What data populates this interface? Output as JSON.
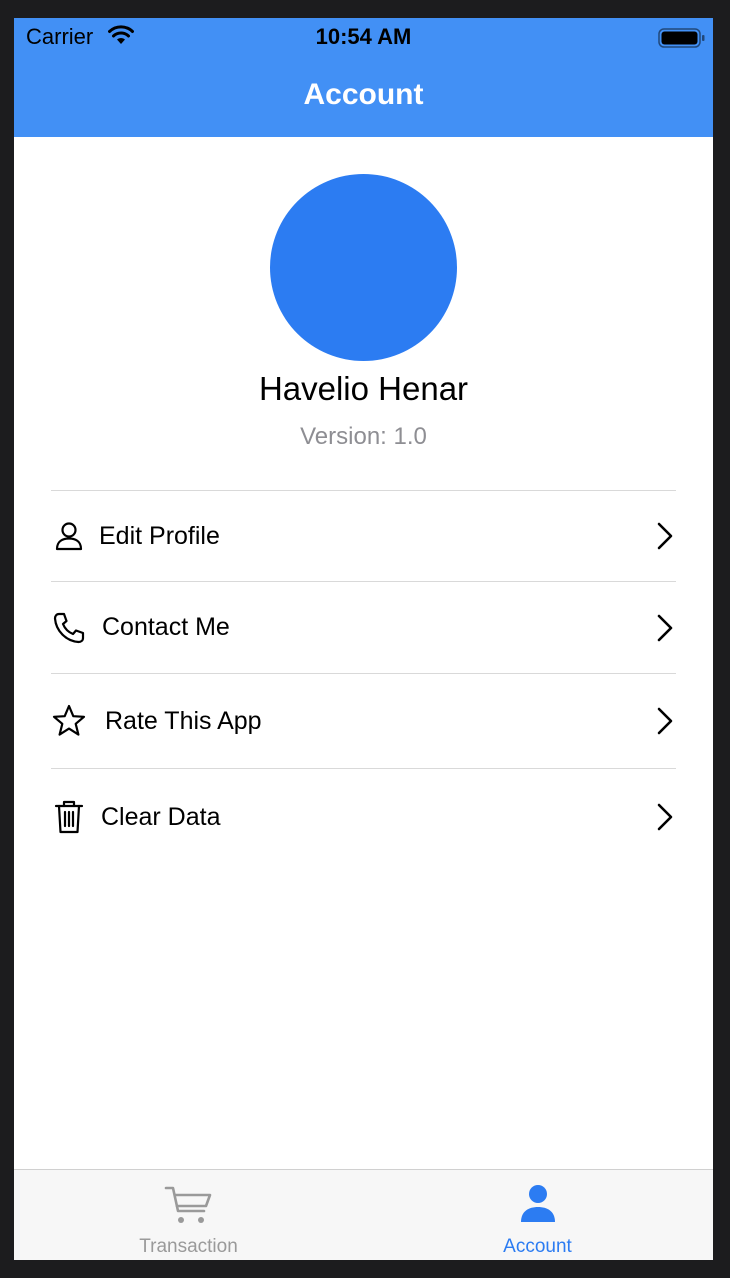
{
  "status_bar": {
    "carrier": "Carrier",
    "time": "10:54 AM"
  },
  "nav": {
    "title": "Account"
  },
  "profile": {
    "name": "Havelio Henar",
    "version": "Version: 1.0",
    "avatar_color": "#2c7cf2"
  },
  "menu": {
    "items": [
      {
        "label": "Edit Profile",
        "icon": "person-icon"
      },
      {
        "label": "Contact Me",
        "icon": "phone-icon"
      },
      {
        "label": "Rate This App",
        "icon": "star-icon"
      },
      {
        "label": "Clear Data",
        "icon": "trash-icon"
      }
    ]
  },
  "tabbar": {
    "tabs": [
      {
        "label": "Transaction",
        "icon": "cart-icon",
        "active": false
      },
      {
        "label": "Account",
        "icon": "person-fill-icon",
        "active": true
      }
    ]
  },
  "colors": {
    "header": "#4290f5",
    "accent": "#2c7cf2",
    "inactive_tab": "#9a9a9a"
  }
}
